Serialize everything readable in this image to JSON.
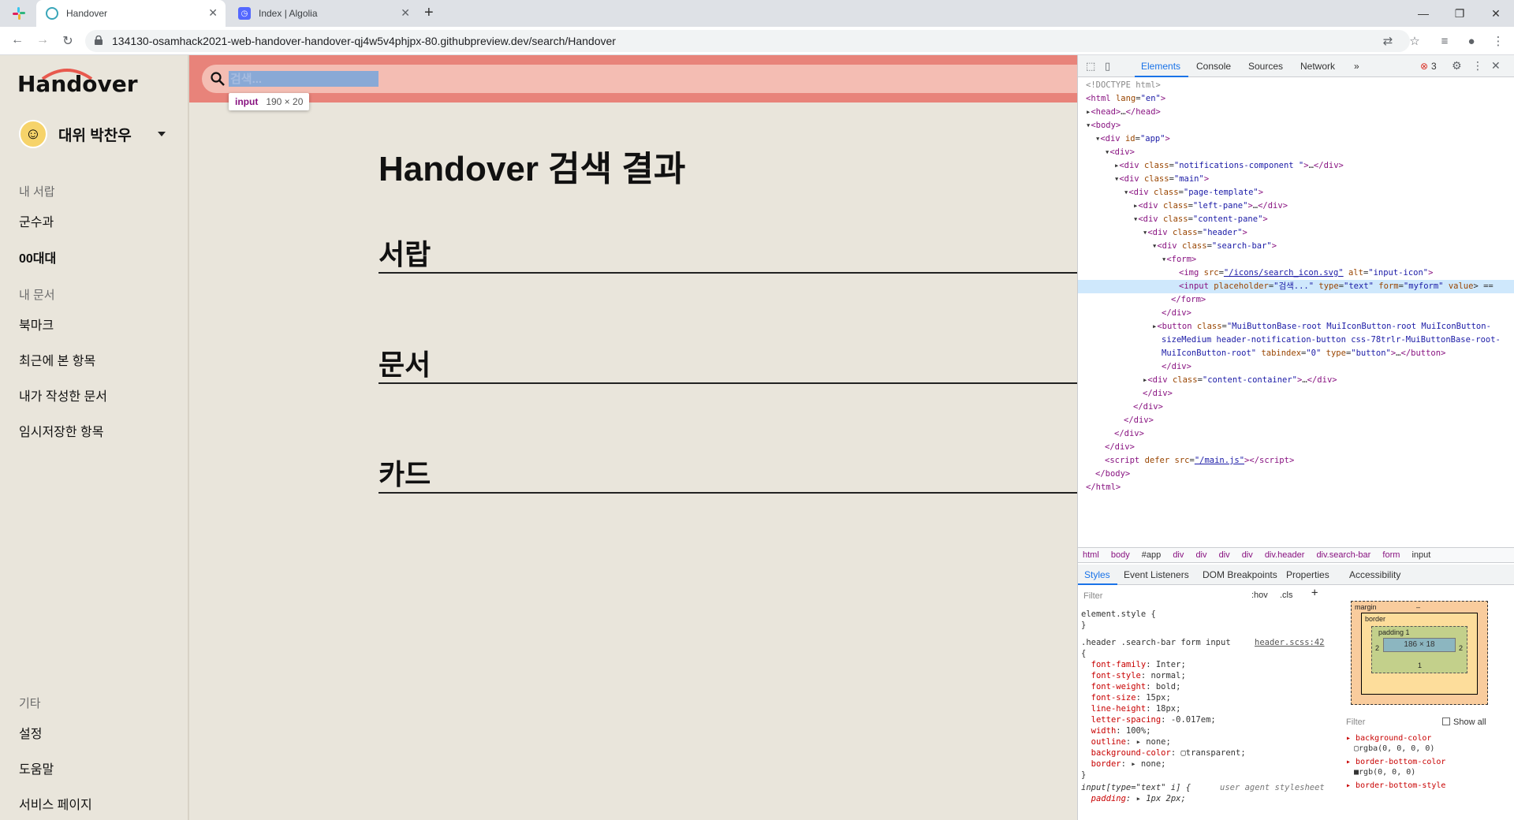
{
  "browser": {
    "tabs": [
      {
        "title": "Handover",
        "active": true
      },
      {
        "title": "Index | Algolia",
        "active": false
      }
    ],
    "url": "134130-osamhack2021-web-handover-handover-qj4w5v4phjpx-80.githubpreview.dev/search/Handover"
  },
  "app": {
    "logo": "Handover",
    "user": "대위 박찬우",
    "sidebar": {
      "sections": [
        {
          "title": "내 서랍",
          "items": [
            "군수과",
            "00대대"
          ]
        },
        {
          "title": "내 문서",
          "items": [
            "북마크",
            "최근에 본 항목",
            "내가 작성한 문서",
            "임시저장한 항목"
          ]
        },
        {
          "title": "기타",
          "items": [
            "설정",
            "도움말",
            "서비스 페이지"
          ]
        }
      ]
    },
    "search": {
      "placeholder": "검색..."
    },
    "tooltip": {
      "tag": "input",
      "size": "190 × 20"
    },
    "page_title": "Handover 검색 결과",
    "result_sections": [
      "서랍",
      "문서",
      "카드"
    ]
  },
  "devtools": {
    "tabs": [
      "Elements",
      "Console",
      "Sources",
      "Network"
    ],
    "error_count": "3",
    "breadcrumbs": [
      "html",
      "body",
      "#app",
      "div",
      "div",
      "div",
      "div",
      "div.header",
      "div.search-bar",
      "form",
      "input"
    ],
    "subtabs": [
      "Styles",
      "Event Listeners",
      "DOM Breakpoints",
      "Properties",
      "Accessibility"
    ],
    "filter_placeholder": "Filter",
    "hov": ":hov",
    "cls": ".cls",
    "show_all": "Show all",
    "rule_source": "header.scss:42",
    "ua_label": "user agent stylesheet",
    "boxmodel": {
      "margin": "margin",
      "border": "border",
      "padding": "padding 1",
      "content": "186 × 18",
      "side": "2",
      "bottom": "1",
      "dash": "–"
    },
    "computed": [
      {
        "prop": "background-color",
        "val": "rgba(0, 0, 0, 0)"
      },
      {
        "prop": "border-bottom-color",
        "val": "rgb(0, 0, 0)"
      },
      {
        "prop": "border-bottom-style",
        "val": ""
      }
    ]
  }
}
